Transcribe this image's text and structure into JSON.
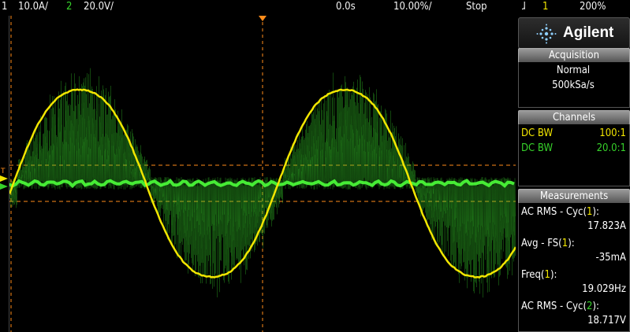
{
  "top": {
    "ch1_num": "1",
    "ch1_scale": "10.0A/",
    "ch2_num": "2",
    "ch2_scale": "20.0V/",
    "time_delay": "0.0s",
    "time_scale": "10.00%/",
    "run_state": "Stop",
    "trig_icon": "ɺ",
    "trig_src": "1",
    "trig_level": "200%"
  },
  "brand": "Agilent",
  "acquisition": {
    "header": "Acquisition",
    "mode": "Normal",
    "rate": "500kSa/s"
  },
  "channels": {
    "header": "Channels",
    "ch1_coupling": "DC BW",
    "ch1_probe": "100:1",
    "ch2_coupling": "DC BW",
    "ch2_probe": "20.0:1"
  },
  "measurements": {
    "header": "Measurements",
    "items": [
      {
        "label_pre": "AC RMS - Cyc(",
        "ch": "1",
        "label_post": "):",
        "value": "17.823A",
        "color": "#f2e600"
      },
      {
        "label_pre": "Avg - FS(",
        "ch": "1",
        "label_post": "):",
        "value": "-35mA",
        "color": "#f2e600"
      },
      {
        "label_pre": "Freq(",
        "ch": "1",
        "label_post": "):",
        "value": "19.029Hz",
        "color": "#f2e600"
      },
      {
        "label_pre": "AC RMS - Cyc(",
        "ch": "2",
        "label_post": "):",
        "value": "18.717V",
        "color": "#36d12a"
      }
    ]
  },
  "colors": {
    "ch1": "#f2e600",
    "ch2": "#36d12a",
    "trigger": "#ff8c1a"
  }
}
